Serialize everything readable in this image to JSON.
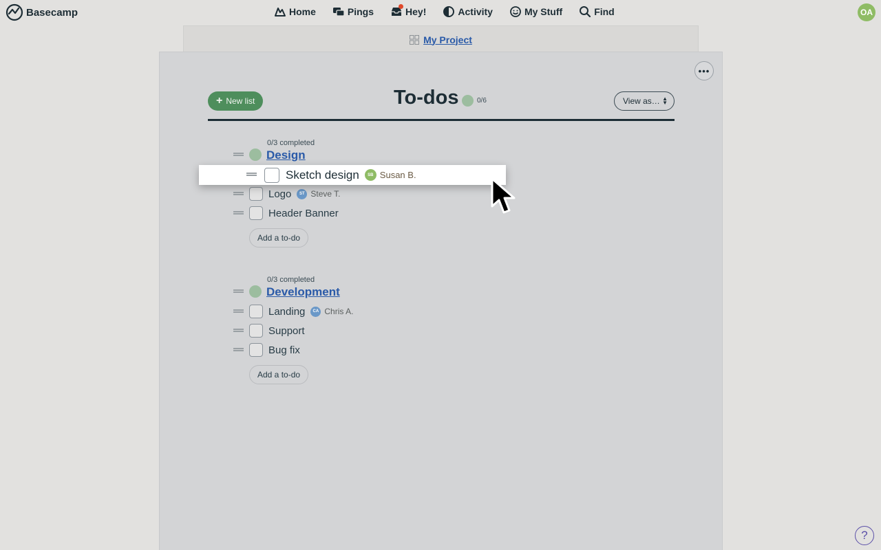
{
  "app": {
    "brand": "Basecamp"
  },
  "nav": {
    "items": [
      {
        "label": "Home",
        "icon": "home-icon"
      },
      {
        "label": "Pings",
        "icon": "pings-icon"
      },
      {
        "label": "Hey!",
        "icon": "hey-icon"
      },
      {
        "label": "Activity",
        "icon": "activity-icon"
      },
      {
        "label": "My Stuff",
        "icon": "my-stuff-icon"
      },
      {
        "label": "Find",
        "icon": "search-icon"
      }
    ],
    "user_initials": "OA"
  },
  "project": {
    "name": "My Project"
  },
  "page": {
    "title": "To-dos",
    "count": "0/6",
    "new_list_label": "New list",
    "view_as_label": "View as…",
    "more_label": "•••"
  },
  "lists": [
    {
      "completed": "0/3 completed",
      "title": "Design",
      "add_label": "Add a to-do",
      "todos": [
        {
          "text": "Sketch design",
          "assignee": "Susan B.",
          "initials": "SB",
          "dragging": true
        },
        {
          "text": "Logo",
          "assignee": "Steve T.",
          "initials": "ST"
        },
        {
          "text": "Header Banner"
        }
      ]
    },
    {
      "completed": "0/3 completed",
      "title": "Development",
      "add_label": "Add a to-do",
      "todos": [
        {
          "text": "Landing",
          "assignee": "Chris A.",
          "initials": "CA"
        },
        {
          "text": "Support"
        },
        {
          "text": "Bug fix"
        }
      ]
    }
  ],
  "help_label": "?",
  "colors": {
    "accent_green": "#4e8e5c",
    "link_blue": "#2a5aa8",
    "avatar_green": "#8fbc65",
    "avatar_blue": "#6a98c8"
  }
}
